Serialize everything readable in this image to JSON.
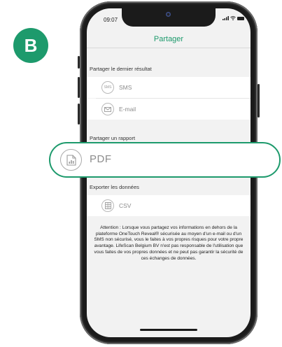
{
  "step_badge": "B",
  "status_bar": {
    "time": "09:07"
  },
  "header": {
    "title": "Partager"
  },
  "sections": {
    "last_result": {
      "label": "Partager le dernier résultat",
      "items": [
        {
          "label": "SMS",
          "icon": "sms-icon",
          "icon_text": "SMS"
        },
        {
          "label": "E-mail",
          "icon": "email-icon"
        }
      ]
    },
    "report": {
      "label": "Partager un rapport",
      "items": [
        {
          "label": "PDF",
          "icon": "pdf-document-icon"
        }
      ]
    },
    "export": {
      "label": "Exporter les données",
      "items": [
        {
          "label": "CSV",
          "icon": "csv-spreadsheet-icon"
        }
      ]
    }
  },
  "notice": "Attention : Lorsque vous partagez vos informations en dehors de la plateforme OneTouch Reveal® sécurisée au moyen d'un e-mail ou d'un SMS non sécurisé, vous le faites à vos propres risques pour votre propre avantage. LifeScan Belgium BV n'est pas responsable de l'utilisation que vous faites de vos propres données et ne peut pas garantir la sécurité de ces échanges de données.",
  "colors": {
    "accent": "#1d9a6c",
    "screen_bg": "#f2f2f2",
    "row_bg": "#ffffff",
    "icon_gray": "#9a9a9a"
  }
}
